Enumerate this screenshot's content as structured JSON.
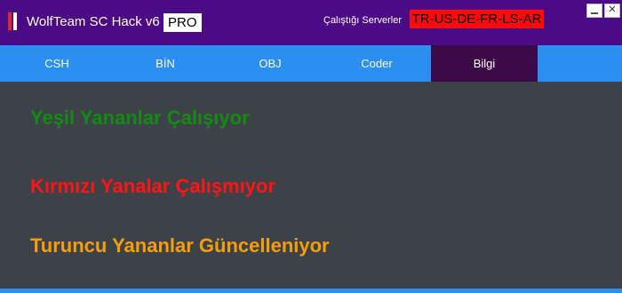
{
  "window": {
    "title": "WolfTeam SC Hack v6",
    "badge": "PRO",
    "servers_label": "Çalıştığı Serverler",
    "servers_value": "TR-US-DE-FR-LS-AR",
    "close_glyph": "✕"
  },
  "tabs": [
    {
      "label": "CSH"
    },
    {
      "label": "BİN"
    },
    {
      "label": "OBJ"
    },
    {
      "label": "Coder"
    },
    {
      "label": "Bilgi",
      "active": true
    }
  ],
  "content": {
    "line_green": "Yeşil Yananlar Çalışıyor",
    "line_red": "Kırmızı Yanalar Çalışmıyor",
    "line_orange": "Turuncu Yananlar Güncelleniyor"
  },
  "colors": {
    "titlebar": "#4b0a86",
    "tabbar": "#2a8ff0",
    "active_tab": "#3b0a47",
    "panel": "#3d4249",
    "green": "#148a14",
    "red": "#ff1414",
    "orange": "#f59e0b",
    "servers_bg": "#ff0a0a"
  }
}
